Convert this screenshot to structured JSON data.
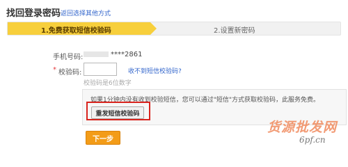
{
  "header": {
    "title": "找回登录密码",
    "alt_method_link": "返回选择其他方式"
  },
  "steps": [
    {
      "label": "1.免费获取短信校验码",
      "active": true
    },
    {
      "label": "2.设置新密码",
      "active": false
    }
  ],
  "form": {
    "phone_label": "手机号码:",
    "phone_value": "****2861",
    "code_required_mark": "*",
    "code_label": "校验码:",
    "code_value": "",
    "no_sms_link": "收不到短信校验码?",
    "code_hint": "校验码是6位数字"
  },
  "notice": {
    "text": "如果1分钟内没有收到校验短信，您可以通过\"短信\"方式获取校验码，此服务免费。",
    "resend_button": "重发短信校验码"
  },
  "actions": {
    "next_button": "下一步"
  },
  "watermark": {
    "text": "货源批发网",
    "url": "6pf.cn"
  },
  "colors": {
    "step_active": "#f7cf3c",
    "link": "#3366cc",
    "highlight_box": "#d9231d",
    "next_button": "#f39c18"
  }
}
